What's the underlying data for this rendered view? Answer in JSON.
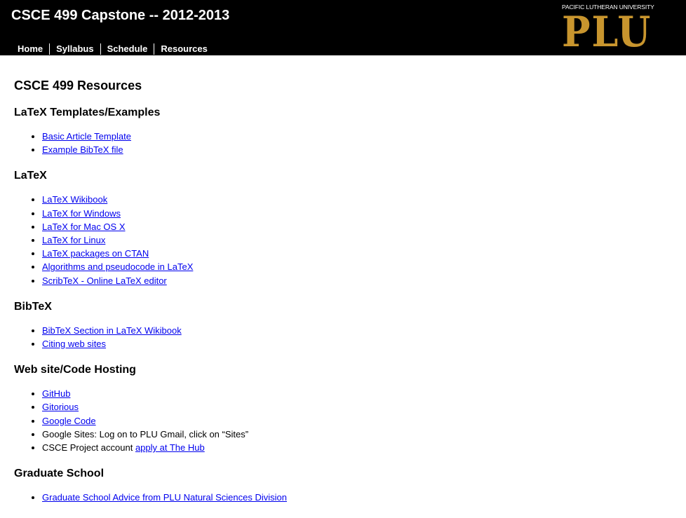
{
  "header": {
    "title": "CSCE 499 Capstone -- 2012-2013",
    "nav": [
      {
        "label": "Home"
      },
      {
        "label": "Syllabus"
      },
      {
        "label": "Schedule"
      },
      {
        "label": "Resources"
      }
    ],
    "logo": {
      "subtitle": "PACIFIC LUTHERAN UNIVERSITY",
      "text": "PLU"
    }
  },
  "colors": {
    "header_bg": "#000000",
    "logo_gold": "#c8952e",
    "link": "#0000ee"
  },
  "main": {
    "heading": "CSCE 499 Resources",
    "sections": [
      {
        "heading": "LaTeX Templates/Examples",
        "items": [
          {
            "link": "Basic Article Template"
          },
          {
            "link": "Example BibTeX file"
          }
        ]
      },
      {
        "heading": "LaTeX",
        "items": [
          {
            "link": "LaTeX Wikibook"
          },
          {
            "link": "LaTeX for Windows"
          },
          {
            "link": "LaTeX for Mac OS X"
          },
          {
            "link": "LaTeX for Linux"
          },
          {
            "link": "LaTeX packages on CTAN"
          },
          {
            "link": "Algorithms and pseudocode in LaTeX"
          },
          {
            "link": "ScribTeX - Online LaTeX editor"
          }
        ]
      },
      {
        "heading": "BibTeX",
        "items": [
          {
            "link": "BibTeX Section in LaTeX Wikibook"
          },
          {
            "link": "Citing web sites"
          }
        ]
      },
      {
        "heading": "Web site/Code Hosting",
        "items": [
          {
            "link": "GitHub"
          },
          {
            "link": "Gitorious"
          },
          {
            "link": "Google Code"
          },
          {
            "text": "Google Sites: Log on to PLU Gmail, click on “Sites”"
          },
          {
            "text": "CSCE Project account ",
            "link": "apply at The Hub"
          }
        ]
      },
      {
        "heading": "Graduate School",
        "items": [
          {
            "link": "Graduate School Advice from PLU Natural Sciences Division"
          }
        ]
      }
    ]
  }
}
